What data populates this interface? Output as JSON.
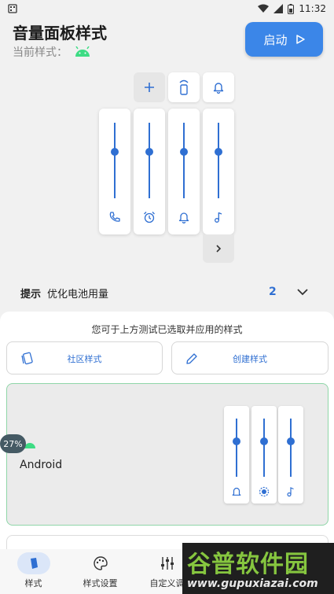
{
  "status_bar": {
    "time": "11:32"
  },
  "header": {
    "title": "音量面板样式",
    "current_style_label": "当前样式：",
    "start_button_label": "启动"
  },
  "preview": {
    "top_chips": [
      "plus-icon",
      "speaker-icon",
      "bell-icon"
    ],
    "sliders": [
      {
        "icon": "phone-icon",
        "level": 0.6
      },
      {
        "icon": "alarm-icon",
        "level": 0.6
      },
      {
        "icon": "bell-icon",
        "level": 0.6
      },
      {
        "icon": "music-note-icon",
        "level": 0.6
      }
    ]
  },
  "tip": {
    "label": "提示",
    "text": "优化电池用量",
    "count": "2"
  },
  "sheet": {
    "hint": "您可于上方测试已选取并应用的样式",
    "community_button": "社区样式",
    "create_button": "创建样式"
  },
  "style_card": {
    "badge": "27%",
    "name": "Android",
    "sliders": [
      {
        "icon": "bell-icon",
        "level": 0.6
      },
      {
        "icon": "brightness-icon",
        "level": 0.6
      },
      {
        "icon": "music-note-icon",
        "level": 0.6
      }
    ]
  },
  "bottom_nav": {
    "items": [
      {
        "label": "样式",
        "icon": "style-icon",
        "active": true
      },
      {
        "label": "样式设置",
        "icon": "palette-icon",
        "active": false
      },
      {
        "label": "自定义调",
        "icon": "sliders-icon",
        "active": false
      }
    ]
  },
  "watermark": {
    "title": "谷普软件园",
    "url": "www.gupuxiazai.com"
  },
  "colors": {
    "accent": "#2f6fd2",
    "start_button": "#3b86e8",
    "android_green": "#3ddc84",
    "selected_border": "#8fd6a8"
  }
}
